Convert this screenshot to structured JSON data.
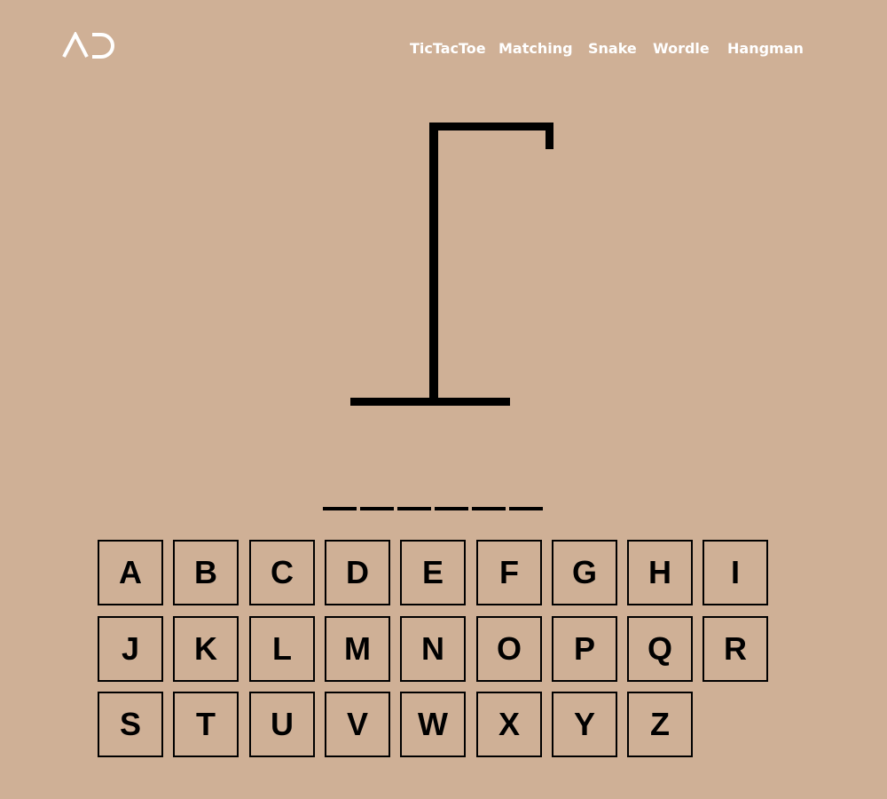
{
  "logo": {
    "text": "AD",
    "color": "#ffffff"
  },
  "nav": {
    "items": [
      {
        "label": "TicTacToe"
      },
      {
        "label": "Matching"
      },
      {
        "label": "Snake"
      },
      {
        "label": "Wordle"
      },
      {
        "label": "Hangman"
      }
    ]
  },
  "game": {
    "word_length": 6,
    "guessed_letters": [],
    "revealed": [
      "",
      "",
      "",
      "",
      "",
      ""
    ],
    "wrong_guesses": 0
  },
  "keyboard": {
    "rows": [
      [
        "A",
        "B",
        "C",
        "D",
        "E",
        "F",
        "G",
        "H",
        "I"
      ],
      [
        "J",
        "K",
        "L",
        "M",
        "N",
        "O",
        "P",
        "Q",
        "R"
      ],
      [
        "S",
        "T",
        "U",
        "V",
        "W",
        "X",
        "Y",
        "Z"
      ]
    ]
  },
  "colors": {
    "background": "#cfb096",
    "ink": "#000000",
    "nav_text": "#ffffff"
  }
}
